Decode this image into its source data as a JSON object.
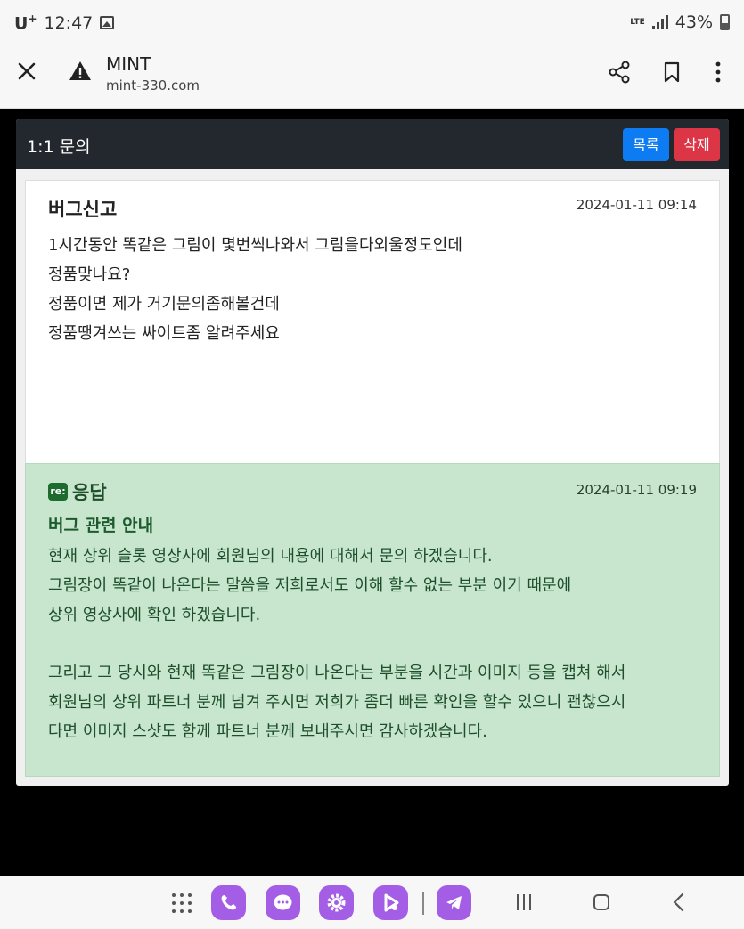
{
  "status_bar": {
    "carrier": "U",
    "carrier_sup": "+",
    "time": "12:47",
    "network": "LTE",
    "battery": "43%"
  },
  "browser": {
    "title": "MINT",
    "url": "mint-330.com"
  },
  "panel": {
    "title": "1:1 문의",
    "list_button": "목록",
    "delete_button": "삭제"
  },
  "question": {
    "title": "버그신고",
    "date": "2024-01-11 09:14",
    "lines": [
      "1시간동안 똑같은 그림이 몇번씩나와서 그림을다외울정도인데",
      "정품맞나요?",
      "정품이면 제가 거기문의좀해볼건데",
      "정품땡겨쓰는 싸이트좀 알려주세요"
    ]
  },
  "answer": {
    "badge": "re:",
    "label": "응답",
    "date": "2024-01-11 09:19",
    "title": "버그 관련 안내",
    "paragraph1": [
      "현재 상위 슬롯 영상사에 회원님의 내용에 대해서 문의 하겠습니다.",
      "그림장이 똑같이 나온다는 말씀을 저희로서도 이해 할수 없는 부분 이기 때문에",
      "상위 영상사에 확인 하겠습니다."
    ],
    "paragraph2": [
      "그리고 그 당시와 현재 똑같은 그림장이 나온다는 부분을 시간과 이미지 등을 캡쳐 해서",
      "회원님의 상위 파트너 분께 넘겨 주시면 저희가 좀더 빠른 확인을 할수 있으니 괜찮으시",
      "다면 이미지 스샷도 함께 파트너 분께 보내주시면 감사하겠습니다."
    ]
  },
  "colors": {
    "header_bg": "#23272e",
    "list_button": "#0d7cf2",
    "delete_button": "#dc3545",
    "answer_bg": "#c7e6cd",
    "app_icon": "#a45ee5"
  }
}
